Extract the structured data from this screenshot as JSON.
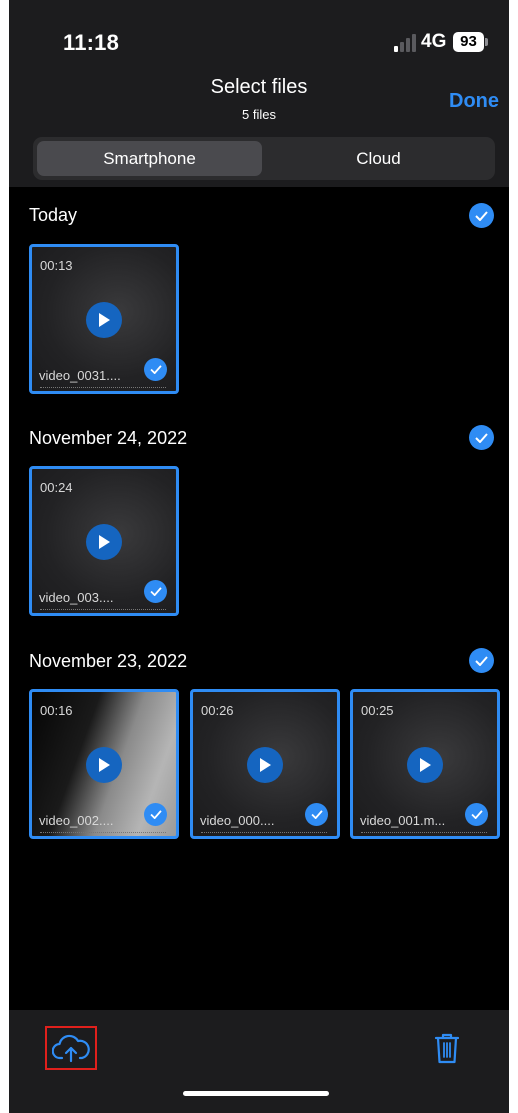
{
  "status": {
    "time": "11:18",
    "network": "4G",
    "battery": "93"
  },
  "nav": {
    "title": "Select files",
    "subtitle": "5 files",
    "done_label": "Done"
  },
  "segmented": {
    "options": [
      "Smartphone",
      "Cloud"
    ],
    "selected": "Smartphone"
  },
  "sections": [
    {
      "title": "Today",
      "videos": [
        {
          "duration": "00:13",
          "name": "video_0031...."
        }
      ]
    },
    {
      "title": "November 24, 2022",
      "videos": [
        {
          "duration": "00:24",
          "name": "video_003...."
        }
      ]
    },
    {
      "title": "November 23, 2022",
      "videos": [
        {
          "duration": "00:16",
          "name": "video_002...."
        },
        {
          "duration": "00:26",
          "name": "video_000...."
        },
        {
          "duration": "00:25",
          "name": "video_001.m..."
        }
      ]
    }
  ],
  "toolbar": {
    "upload_icon": "cloud-upload-icon",
    "delete_icon": "trash-icon"
  },
  "colors": {
    "accent": "#2f8cf4",
    "highlight": "#e0201c",
    "background": "#000000",
    "bar": "#1c1c1e"
  }
}
